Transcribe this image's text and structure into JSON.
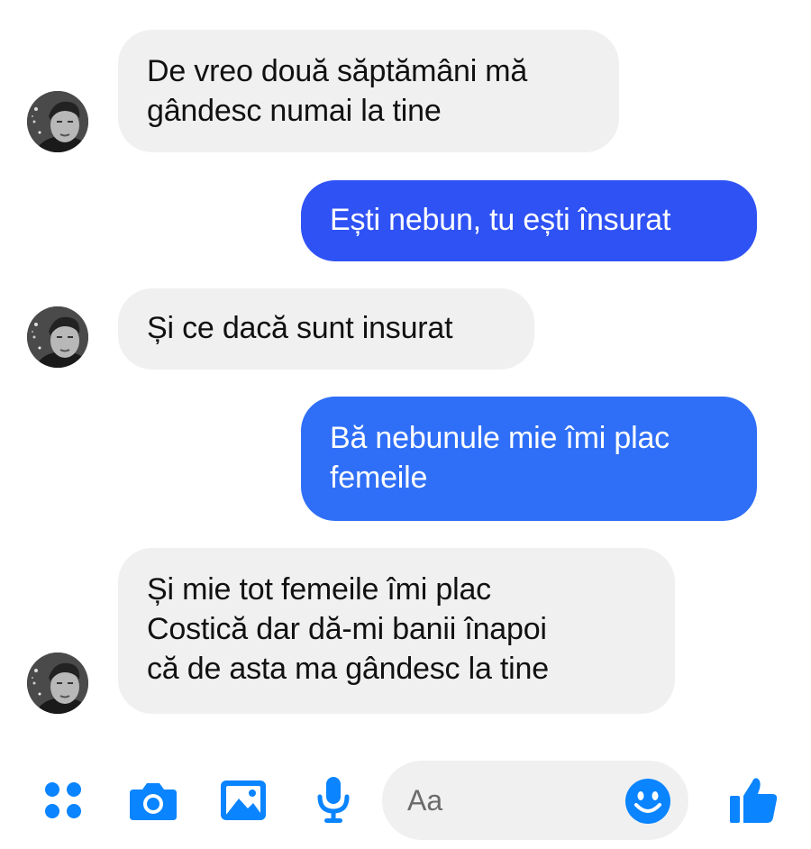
{
  "colors": {
    "outgoing_bubble": "#2f52f5",
    "incoming_bubble": "#f0f0f0",
    "accent_icon": "#0a84ff",
    "avatar_bg": "#3a3a3a"
  },
  "messages": [
    {
      "direction": "incoming",
      "text": "De vreo două săptămâni mă\ngândesc numai la tine",
      "avatar": "contact-avatar"
    },
    {
      "direction": "outgoing",
      "text": "Ești nebun, tu ești însurat"
    },
    {
      "direction": "incoming",
      "text": "Și ce dacă sunt insurat",
      "avatar": "contact-avatar"
    },
    {
      "direction": "outgoing",
      "text": "Bă nebunule mie îmi plac\nfemeile"
    },
    {
      "direction": "incoming",
      "text": "Și mie tot femeile îmi plac\nCostică dar dă-mi banii înapoi\ncă de asta ma gândesc la tine",
      "avatar": "contact-avatar"
    }
  ],
  "composer": {
    "placeholder": "Aa",
    "icons": [
      "menu-dots-icon",
      "camera-icon",
      "image-icon",
      "microphone-icon",
      "emoji-icon",
      "thumbs-up-icon"
    ]
  }
}
